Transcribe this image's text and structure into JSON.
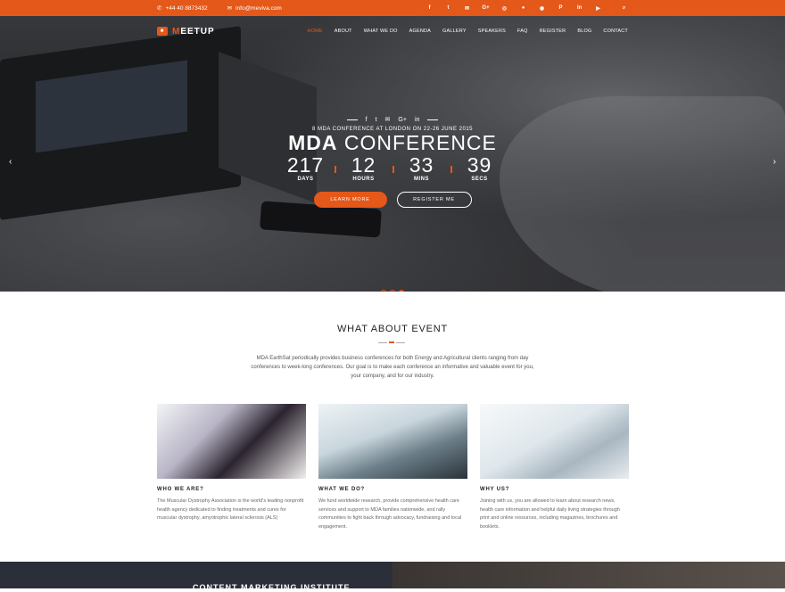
{
  "topbar": {
    "phone": "+44 40 8873432",
    "email": "info@meviva.com",
    "social_icons": [
      "facebook-icon",
      "twitter-icon",
      "mail-icon",
      "google-plus-icon",
      "instagram-icon",
      "flickr-icon",
      "dribbble-icon",
      "pinterest-icon",
      "linkedin-icon",
      "youtube-icon"
    ],
    "social_glyphs": [
      "f",
      "t",
      "✉",
      "G+",
      "◎",
      "●",
      "◉",
      "P",
      "in",
      "▶"
    ],
    "search_glyph": "⌕"
  },
  "nav": {
    "logo_text": "EETUP",
    "logo_initial": "M",
    "items": [
      "HOME",
      "ABOUT",
      "WHAT WE DO",
      "AGENDA",
      "GALLERY",
      "SPEAKERS",
      "FAQ",
      "REGISTER",
      "BLOG",
      "CONTACT"
    ]
  },
  "hero": {
    "social": [
      "f",
      "t",
      "✉",
      "G+",
      "in"
    ],
    "subtitle": "8 MDA CONFERENCE AT LONDON ON 22-26 JUNE 2015",
    "title_bold": "MDA",
    "title_rest": "CONFERENCE",
    "countdown": [
      {
        "value": "217",
        "label": "DAYS"
      },
      {
        "value": "12",
        "label": "HOURS"
      },
      {
        "value": "33",
        "label": "MINS"
      },
      {
        "value": "39",
        "label": "SECS"
      }
    ],
    "learn_more": "LEARN MORE",
    "register": "REGISTER ME",
    "prev_glyph": "‹",
    "next_glyph": "›",
    "slides": 3,
    "active_slide": 3
  },
  "about": {
    "title": "WHAT ABOUT EVENT",
    "intro": "MDA EarthSat periodically provides business conferences for both Energy and Agricultural clients ranging from day conferences to week-long conferences. Our goal is to make each conference an informative and valuable event for you, your company, and for our industry.",
    "cards": [
      {
        "heading": "WHO WE ARE?",
        "text": "The Muscular Dystrophy Association is the world's leading nonprofit health agency dedicated to finding treatments and cures for muscular dystrophy, amyotrophic lateral sclerosis (ALS)"
      },
      {
        "heading": "WHAT WE DO?",
        "text": "We fund worldwide research, provide comprehensive health care services and support to MDA families nationwide, and rally communities to fight back through advocacy, fundraising and local engagement."
      },
      {
        "heading": "WHY US?",
        "text": "Joining with us, you are allowed to learn about research news, health care information and helpful daily living strategies through print and online resources, including magazines, brochures and booklets."
      }
    ]
  },
  "bottom": {
    "title": "CONTENT MARKETING INSTITUTE"
  },
  "colors": {
    "accent": "#e4581a"
  }
}
